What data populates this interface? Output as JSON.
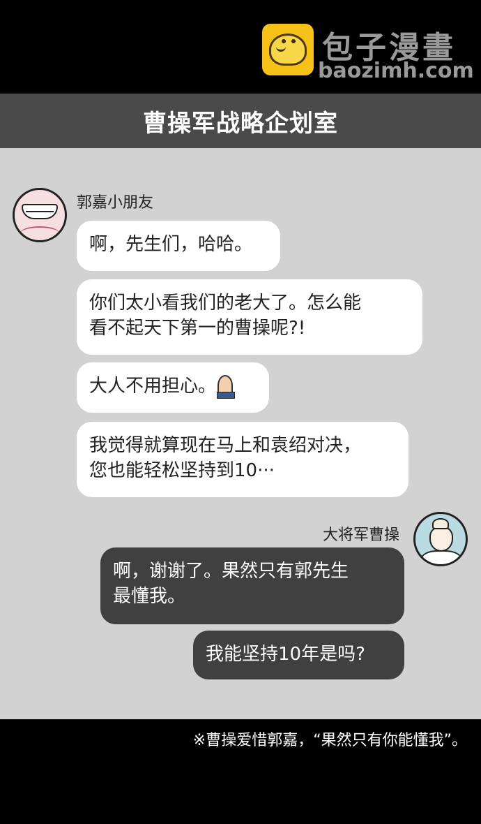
{
  "watermark": {
    "logo_cn": "包子漫畫",
    "logo_en": "baozimh.com"
  },
  "header": {
    "title": "曹操军战略企划室"
  },
  "chat": {
    "sender_left": "郭嘉小朋友",
    "sender_right": "大将军曹操",
    "messages": [
      {
        "side": "left",
        "text": "啊，先生们，哈哈。"
      },
      {
        "side": "left",
        "text": "你们太小看我们的老大了。怎么能\n看不起天下第一的曹操呢?!"
      },
      {
        "side": "left",
        "text": "大人不用担心。",
        "icon": "praying-hands-icon"
      },
      {
        "side": "left",
        "text": "我觉得就算现在马上和袁绍对决，\n您也能轻松坚持到10···"
      },
      {
        "side": "right",
        "text": "啊，谢谢了。果然只有郭先生\n最懂我。"
      },
      {
        "side": "right",
        "text": "我能坚持10年是吗?"
      }
    ]
  },
  "footnote": "※曹操爱惜郭嘉，“果然只有你能懂我”。",
  "colors": {
    "header_bg": "#4a4a4a",
    "chat_bg": "#d2d2d2",
    "incoming_bubble": "#ffffff",
    "outgoing_bubble": "#404040"
  }
}
